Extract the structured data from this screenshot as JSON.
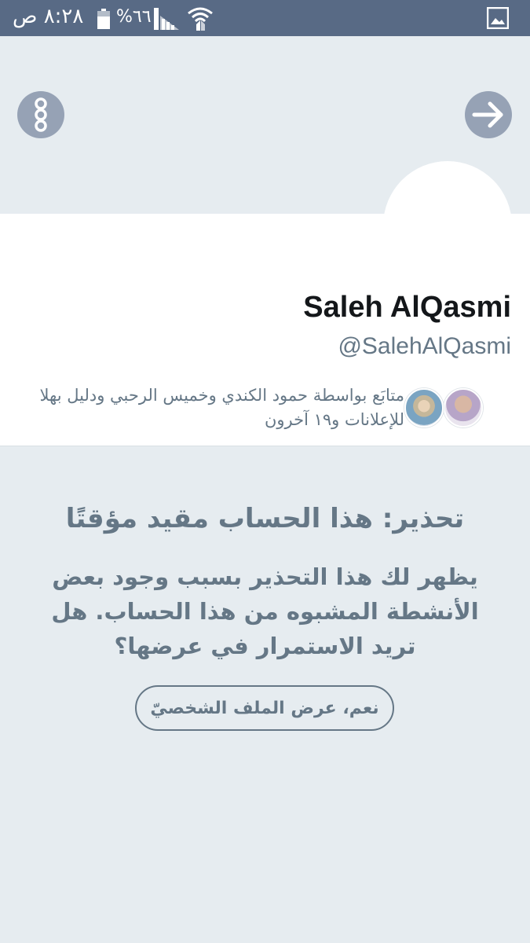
{
  "status_bar": {
    "time": "٨:٢٨ ص",
    "battery": "%٦٦",
    "icons": [
      "battery-icon",
      "signal-icon",
      "wifi-icon",
      "gallery-icon"
    ]
  },
  "header": {
    "more_icon": "more-vertical-icon",
    "forward_icon": "arrow-right-icon"
  },
  "profile": {
    "name": "Saleh AlQasmi",
    "handle": "@SalehAlQasmi",
    "followers_text": "متابَع بواسطة حمود الكندي وخميس الرحبي ودليل بهلا للإعلانات و١٩ آخرون"
  },
  "warning": {
    "title": "تحذير: هذا الحساب مقيد مؤقتًا",
    "body": "يظهر لك هذا التحذير بسبب وجود بعض الأنشطة المشبوه من هذا الحساب. هل تريد الاستمرار في عرضها؟",
    "button_label": "نعم، عرض الملف الشخصيّ"
  },
  "colors": {
    "status_bar": "#586a85",
    "background": "#e6ecf0",
    "circle_button": "#96a2b5",
    "secondary_text": "#657786",
    "primary_text": "#14171a"
  }
}
